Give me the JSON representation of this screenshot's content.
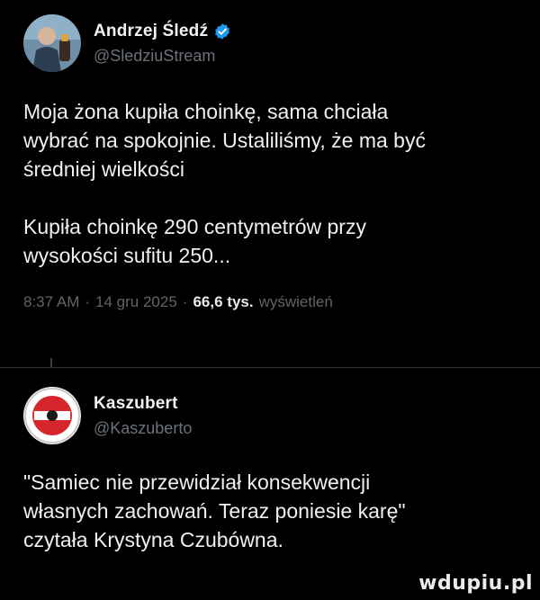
{
  "tweet_main": {
    "display_name": "Andrzej Śledź",
    "handle": "@SledziuStream",
    "verified": true,
    "text": "Moja żona kupiła choinkę, sama chciała\nwybrać na spokojnie. Ustaliliśmy, że ma być\nśredniej wielkości\n\nKupiła choinkę 290 centymetrów przy\nwysokości sufitu 250...",
    "time": "8:37 AM",
    "date": "14 gru 2025",
    "separator": "·",
    "views_count": "66,6 tys.",
    "views_label": "wyświetleń"
  },
  "tweet_reply": {
    "display_name": "Kaszubert",
    "handle": "@Kaszuberto",
    "text": "\"Samiec nie przewidział konsekwencji\nwłasnych zachowań. Teraz poniesie karę\"\nczytała Krystyna Czubówna."
  },
  "watermark": "wdupiu.pl",
  "colors": {
    "background": "#000000",
    "text": "#e7e9ea",
    "secondary": "#6b7178",
    "verified": "#1d9bf0"
  },
  "icons": {
    "verified": "verified-badge-icon"
  }
}
